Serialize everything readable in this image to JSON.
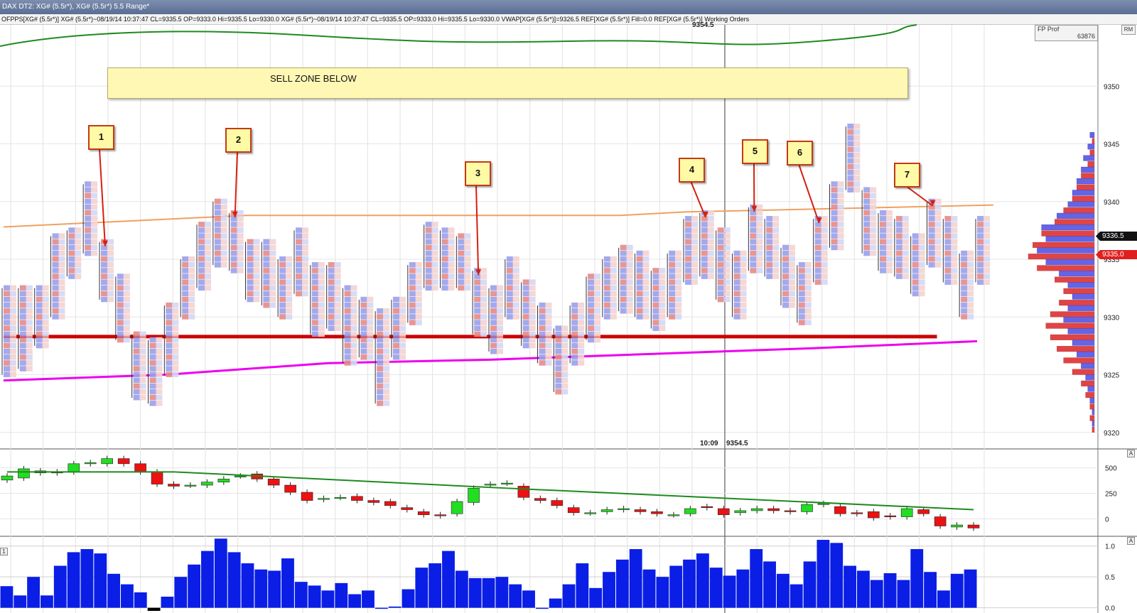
{
  "window": {
    "title": "DAX DT2: XG# (5.5r*), XG# (5.5r*) 5.5 Range*",
    "legend": "OFPPS[XG# (5.5r*)]  XG# (5.5r*)~08/19/14 10:37:47 CL=9335.5 OP=9333.0 Hi=9335.5 Lo=9330.0   XG# (5.5r*)~08/19/14 10:37:47 CL=9335.5 OP=9333.0 Hi=9335.5 Lo=9330.0  VWAP[XG# (5.5r*)]=9326.5  REF[XG# (5.5r*)] Fill=0.0  REF[XG# (5.5r*)] Working Orders"
  },
  "profile_box": {
    "name": "FP Prof",
    "value": "63876"
  },
  "rm_label": "RM",
  "sell_zone": {
    "label": "SELL ZONE BELOW"
  },
  "annotations": [
    "1",
    "2",
    "3",
    "4",
    "5",
    "6",
    "7"
  ],
  "header_price": "9354.5",
  "cursor_readout": {
    "time": "10:09",
    "price": "9354.5"
  },
  "price_tags": [
    {
      "label": "9336.5",
      "color": "#111111"
    },
    {
      "label": "9335.0",
      "color": "#e02020"
    }
  ],
  "pane_tags": [
    "A",
    "A",
    "1"
  ],
  "colors": {
    "up_candle": "#22dd22",
    "down_candle": "#ee1111",
    "vwap": "#ee00ee",
    "ma_upper": "#1e8a1e",
    "ref_line": "#cc0000",
    "orange_line": "#f0a060",
    "volume_bar": "#0a1ee6",
    "profile_bid": "#e04444",
    "profile_ask": "#6464e6"
  },
  "chart_data": [
    {
      "type": "footprint",
      "title": "",
      "y_axis_ticks": [
        9350,
        9345,
        9340,
        9335,
        9330,
        9325,
        9320
      ],
      "ylim": [
        9319,
        9355
      ],
      "bars": [
        {
          "hi": 9332.5,
          "lo": 9325.0
        },
        {
          "hi": 9332.5,
          "lo": 9325.5
        },
        {
          "hi": 9332.5,
          "lo": 9327.5
        },
        {
          "hi": 9337.0,
          "lo": 9330.0
        },
        {
          "hi": 9337.5,
          "lo": 9333.5
        },
        {
          "hi": 9341.5,
          "lo": 9335.5
        },
        {
          "hi": 9336.5,
          "lo": 9331.5
        },
        {
          "hi": 9333.5,
          "lo": 9328.0
        },
        {
          "hi": 9328.5,
          "lo": 9323.0
        },
        {
          "hi": 9328.0,
          "lo": 9322.5
        },
        {
          "hi": 9331.0,
          "lo": 9325.0
        },
        {
          "hi": 9335.0,
          "lo": 9330.0
        },
        {
          "hi": 9338.0,
          "lo": 9332.5
        },
        {
          "hi": 9340.0,
          "lo": 9334.5
        },
        {
          "hi": 9339.0,
          "lo": 9334.0
        },
        {
          "hi": 9336.5,
          "lo": 9331.5
        },
        {
          "hi": 9336.5,
          "lo": 9331.0
        },
        {
          "hi": 9335.0,
          "lo": 9330.0
        },
        {
          "hi": 9337.5,
          "lo": 9332.0
        },
        {
          "hi": 9334.5,
          "lo": 9328.5
        },
        {
          "hi": 9334.5,
          "lo": 9329.0
        },
        {
          "hi": 9332.5,
          "lo": 9326.0
        },
        {
          "hi": 9331.5,
          "lo": 9326.5
        },
        {
          "hi": 9330.5,
          "lo": 9322.5
        },
        {
          "hi": 9331.5,
          "lo": 9326.5
        },
        {
          "hi": 9334.5,
          "lo": 9329.5
        },
        {
          "hi": 9338.0,
          "lo": 9332.5
        },
        {
          "hi": 9337.5,
          "lo": 9332.5
        },
        {
          "hi": 9337.0,
          "lo": 9332.5
        },
        {
          "hi": 9334.0,
          "lo": 9328.5
        },
        {
          "hi": 9332.5,
          "lo": 9327.0
        },
        {
          "hi": 9335.0,
          "lo": 9330.0
        },
        {
          "hi": 9333.0,
          "lo": 9327.5
        },
        {
          "hi": 9331.0,
          "lo": 9326.0
        },
        {
          "hi": 9329.0,
          "lo": 9323.5
        },
        {
          "hi": 9331.0,
          "lo": 9326.0
        },
        {
          "hi": 9333.5,
          "lo": 9328.0
        },
        {
          "hi": 9335.0,
          "lo": 9330.0
        },
        {
          "hi": 9336.0,
          "lo": 9330.5
        },
        {
          "hi": 9335.5,
          "lo": 9330.0
        },
        {
          "hi": 9334.0,
          "lo": 9329.0
        },
        {
          "hi": 9335.5,
          "lo": 9330.0
        },
        {
          "hi": 9338.5,
          "lo": 9333.0
        },
        {
          "hi": 9339.0,
          "lo": 9333.5
        },
        {
          "hi": 9337.5,
          "lo": 9331.5
        },
        {
          "hi": 9335.5,
          "lo": 9330.0
        },
        {
          "hi": 9339.5,
          "lo": 9334.0
        },
        {
          "hi": 9338.5,
          "lo": 9333.5
        },
        {
          "hi": 9336.0,
          "lo": 9331.0
        },
        {
          "hi": 9334.5,
          "lo": 9329.5
        },
        {
          "hi": 9338.5,
          "lo": 9333.0
        },
        {
          "hi": 9341.5,
          "lo": 9336.0
        },
        {
          "hi": 9346.5,
          "lo": 9341.0
        },
        {
          "hi": 9341.0,
          "lo": 9335.5
        },
        {
          "hi": 9339.0,
          "lo": 9334.0
        },
        {
          "hi": 9338.5,
          "lo": 9333.5
        },
        {
          "hi": 9337.0,
          "lo": 9332.0
        },
        {
          "hi": 9340.0,
          "lo": 9334.5
        },
        {
          "hi": 9338.5,
          "lo": 9333.0
        },
        {
          "hi": 9335.5,
          "lo": 9330.0
        },
        {
          "hi": 9338.5,
          "lo": 9333.0
        }
      ],
      "series": [
        {
          "name": "VWAP",
          "x": [
            0,
            10,
            20,
            30,
            40,
            50,
            61
          ],
          "y": [
            9324.5,
            9325.0,
            9326.0,
            9326.3,
            9326.8,
            9327.3,
            9327.9
          ]
        },
        {
          "name": "REF",
          "x": [
            0,
            57
          ],
          "y": [
            9328.3,
            9328.3
          ]
        }
      ],
      "orange_line": {
        "x": [
          0,
          15,
          38,
          42,
          61
        ],
        "y": [
          9337.8,
          9338.8,
          9338.8,
          9339.1,
          9339.7
        ]
      },
      "annotations": [
        {
          "label": "1",
          "bar": 6
        },
        {
          "label": "2",
          "bar": 14
        },
        {
          "label": "3",
          "bar": 29
        },
        {
          "label": "4",
          "bar": 43
        },
        {
          "label": "5",
          "bar": 46
        },
        {
          "label": "6",
          "bar": 50
        },
        {
          "label": "7",
          "bar": 57
        }
      ],
      "volume_profile": {
        "prices": [
          9346,
          9345,
          9344,
          9343,
          9342,
          9341,
          9340,
          9339,
          9338,
          9337,
          9336,
          9335,
          9334,
          9333,
          9332,
          9331,
          9330,
          9329,
          9328,
          9327,
          9326,
          9325,
          9324,
          9323,
          9322,
          9321,
          9320
        ],
        "bid": [
          0,
          1,
          2,
          3,
          6,
          8,
          10,
          14,
          18,
          24,
          28,
          30,
          26,
          18,
          14,
          16,
          20,
          22,
          20,
          17,
          14,
          10,
          6,
          4,
          2,
          2,
          1
        ],
        "ask": [
          2,
          3,
          5,
          6,
          8,
          10,
          12,
          17,
          24,
          22,
          26,
          22,
          16,
          12,
          10,
          12,
          14,
          12,
          10,
          8,
          6,
          4,
          3,
          2,
          1,
          1,
          0
        ]
      }
    },
    {
      "type": "candlestick",
      "title": "",
      "y_axis_ticks": [
        500,
        250,
        0
      ],
      "ylim": [
        -150,
        650
      ],
      "candles": [
        {
          "o": 380,
          "c": 420
        },
        {
          "o": 400,
          "c": 490
        },
        {
          "o": 450,
          "c": 470
        },
        {
          "o": 460,
          "c": 450
        },
        {
          "o": 460,
          "c": 540
        },
        {
          "o": 540,
          "c": 550
        },
        {
          "o": 540,
          "c": 590
        },
        {
          "o": 590,
          "c": 540
        },
        {
          "o": 540,
          "c": 460
        },
        {
          "o": 460,
          "c": 340
        },
        {
          "o": 340,
          "c": 320
        },
        {
          "o": 330,
          "c": 330
        },
        {
          "o": 330,
          "c": 360
        },
        {
          "o": 360,
          "c": 390
        },
        {
          "o": 420,
          "c": 420
        },
        {
          "o": 440,
          "c": 390
        },
        {
          "o": 390,
          "c": 330
        },
        {
          "o": 330,
          "c": 260
        },
        {
          "o": 260,
          "c": 180
        },
        {
          "o": 190,
          "c": 200
        },
        {
          "o": 210,
          "c": 210
        },
        {
          "o": 220,
          "c": 180
        },
        {
          "o": 180,
          "c": 160
        },
        {
          "o": 170,
          "c": 130
        },
        {
          "o": 110,
          "c": 90
        },
        {
          "o": 70,
          "c": 40
        },
        {
          "o": 40,
          "c": 30
        },
        {
          "o": 50,
          "c": 170
        },
        {
          "o": 160,
          "c": 300
        },
        {
          "o": 330,
          "c": 340
        },
        {
          "o": 350,
          "c": 350
        },
        {
          "o": 320,
          "c": 210
        },
        {
          "o": 200,
          "c": 180
        },
        {
          "o": 180,
          "c": 130
        },
        {
          "o": 110,
          "c": 60
        },
        {
          "o": 60,
          "c": 60
        },
        {
          "o": 70,
          "c": 90
        },
        {
          "o": 90,
          "c": 100
        },
        {
          "o": 90,
          "c": 70
        },
        {
          "o": 70,
          "c": 50
        },
        {
          "o": 40,
          "c": 40
        },
        {
          "o": 50,
          "c": 100
        },
        {
          "o": 120,
          "c": 110
        },
        {
          "o": 100,
          "c": 40
        },
        {
          "o": 60,
          "c": 80
        },
        {
          "o": 80,
          "c": 100
        },
        {
          "o": 100,
          "c": 80
        },
        {
          "o": 80,
          "c": 70
        },
        {
          "o": 70,
          "c": 140
        },
        {
          "o": 140,
          "c": 150
        },
        {
          "o": 120,
          "c": 50
        },
        {
          "o": 60,
          "c": 50
        },
        {
          "o": 70,
          "c": 10
        },
        {
          "o": 30,
          "c": 20
        },
        {
          "o": 20,
          "c": 100
        },
        {
          "o": 90,
          "c": 50
        },
        {
          "o": 20,
          "c": -70
        },
        {
          "o": -80,
          "c": -60
        },
        {
          "o": -60,
          "c": -90
        }
      ],
      "ma_line": {
        "x": [
          0,
          10,
          30,
          60
        ],
        "y": [
          460,
          460,
          300,
          90
        ]
      }
    },
    {
      "type": "bar",
      "title": "",
      "y_axis_ticks": [
        1.0,
        0.5,
        0.0
      ],
      "ylim": [
        -0.05,
        1.1
      ],
      "values": [
        0.35,
        0.2,
        0.5,
        0.2,
        0.68,
        0.9,
        0.95,
        0.88,
        0.55,
        0.38,
        0.25,
        -0.05,
        0.18,
        0.5,
        0.7,
        0.92,
        1.12,
        0.9,
        0.72,
        0.62,
        0.6,
        0.8,
        0.42,
        0.36,
        0.28,
        0.4,
        0.22,
        0.28,
        0.0,
        0.02,
        0.3,
        0.65,
        0.72,
        0.92,
        0.6,
        0.48,
        0.48,
        0.5,
        0.38,
        0.28,
        0.0,
        0.15,
        0.38,
        0.72,
        0.32,
        0.58,
        0.78,
        0.95,
        0.62,
        0.5,
        0.68,
        0.78,
        0.88,
        0.65,
        0.52,
        0.62,
        0.95,
        0.75,
        0.55,
        0.38,
        0.75,
        1.1,
        1.05,
        0.68,
        0.6,
        0.45,
        0.56,
        0.45,
        0.95,
        0.58,
        0.28,
        0.55,
        0.62
      ]
    }
  ]
}
